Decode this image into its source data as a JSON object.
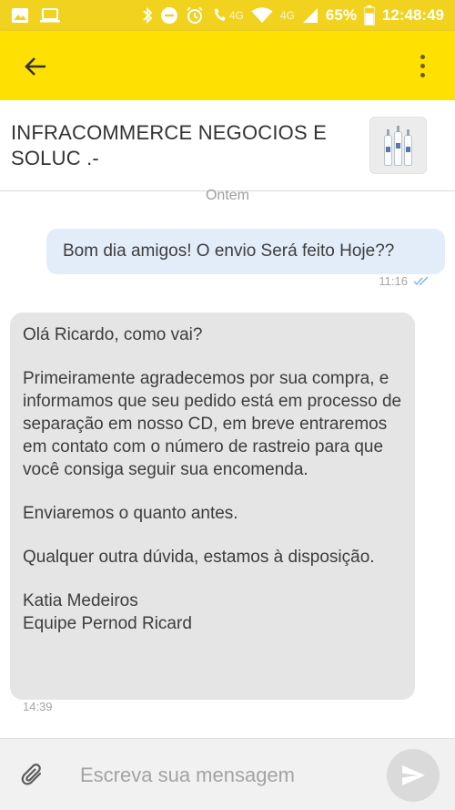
{
  "status_bar": {
    "battery": "65%",
    "time": "12:48:49",
    "network_call": "4G",
    "network_signal": "4G",
    "icons": [
      "image-icon",
      "laptop-icon",
      "bluetooth-icon",
      "do-not-disturb-icon",
      "alarm-icon",
      "wifi-call-icon",
      "wifi-icon",
      "signal-icon",
      "battery-icon"
    ]
  },
  "app_bar": {
    "back_icon": "arrow-back-icon",
    "menu_icon": "more-vertical-icon"
  },
  "conversation": {
    "seller_name": "INFRACOMMERCE NEGOCIOS E SOLUC .-",
    "product_thumbnail": "product-bottles-image"
  },
  "messages": {
    "day_separator": "Ontem",
    "outgoing": {
      "text": "Bom dia amigos! O envio Será feito Hoje??",
      "time": "11:16",
      "status_icon": "double-check-icon"
    },
    "incoming": {
      "paragraphs": [
        "Olá Ricardo, como vai?",
        "Primeiramente agradecemos por sua compra, e informamos que seu pedido está em processo de separação em nosso CD, em breve entraremos em contato com o número de rastreio para que você consiga seguir sua encomenda.",
        "Enviaremos o quanto antes.",
        "Qualquer outra dúvida, estamos à disposição."
      ],
      "signature_name": "Katia Medeiros",
      "signature_team": "Equipe Pernod Ricard",
      "time": "14:39"
    }
  },
  "composer": {
    "placeholder": "Escreva sua mensagem",
    "value": "",
    "attach_icon": "paperclip-icon",
    "send_icon": "send-icon"
  },
  "colors": {
    "status_bar": "#f1d21f",
    "app_bar": "#fee102",
    "outgoing_bubble": "#e3edfa",
    "incoming_bubble": "#e5e5e5",
    "read_check": "#7fb2e5"
  }
}
